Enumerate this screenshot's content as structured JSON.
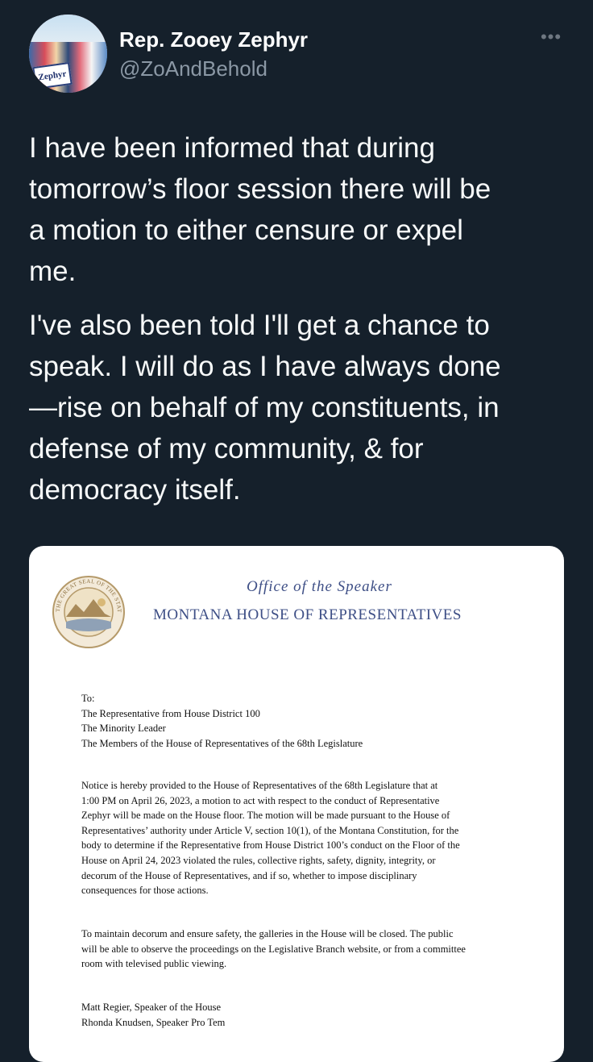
{
  "tweet": {
    "display_name": "Rep. Zooey Zephyr",
    "handle": "@ZoAndBehold",
    "avatar_sign_text": "Zephyr",
    "more_icon": "more-horizontal-icon",
    "paragraphs": [
      [
        "I have been informed that during",
        "tomorrow’s floor session there will be",
        "a motion to either censure or expel",
        "me."
      ],
      [
        "I've also been told I'll get a chance to",
        "speak. I will do as I have always done",
        "—rise on behalf of my constituents, in",
        "defense of my community, & for",
        "democracy itself."
      ]
    ]
  },
  "letter": {
    "office": "Office of the Speaker",
    "house": "MONTANA HOUSE OF REPRESENTATIVES",
    "seal_text": "THE GREAT SEAL OF THE STATE OF MONTANA",
    "to_lines": [
      "To:",
      "The Representative from House District 100",
      "The Minority Leader",
      "The Members of the House of Representatives of the 68th Legislature"
    ],
    "notice_lines": [
      "Notice is hereby provided to the House of Representatives of the 68th Legislature that at",
      "1:00 PM on April 26, 2023, a motion to act with respect to the conduct of Representative",
      "Zephyr will be made on the House floor. The motion will be made pursuant to the House of",
      "Representatives’ authority under Article V, section 10(1), of the Montana Constitution, for the",
      "body to determine if the Representative from House District 100’s conduct on the Floor of the",
      "House on April 24, 2023 violated the rules, collective rights, safety, dignity, integrity, or",
      "decorum of the House of Representatives, and if so, whether to impose disciplinary",
      "consequences for those actions."
    ],
    "closing_lines": [
      "To maintain decorum and ensure safety, the galleries in the House will be closed. The public",
      "will be able to observe the proceedings on the Legislative Branch website, or from a committee",
      "room with televised public viewing."
    ],
    "signatures": [
      "Matt Regier, Speaker of the House",
      "Rhonda Knudsen, Speaker Pro Tem"
    ]
  }
}
